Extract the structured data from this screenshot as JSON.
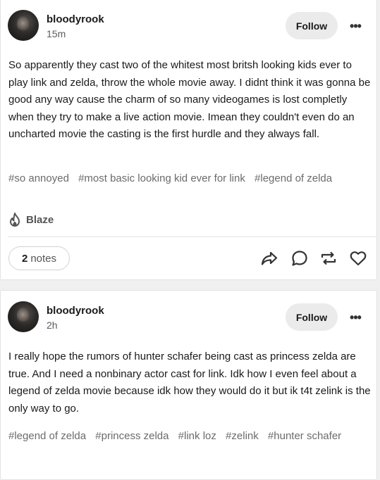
{
  "posts": [
    {
      "username": "bloodyrook",
      "timestamp": "15m",
      "follow_label": "Follow",
      "more_label": "•••",
      "body": "So apparently they cast two of the whitest most britsh looking kids ever to play link and zelda, throw the whole movie away. I didnt think it was gonna be good any way cause the charm of so many videogames is lost completly when they try to make a live action movie. Imean they couldn't even do an uncharted movie the casting is the first hurdle and they always fall.",
      "tags": [
        "#so annoyed",
        "#most basic looking kid ever for link",
        "#legend of zelda"
      ],
      "blaze_label": "Blaze",
      "notes_count": "2",
      "notes_label": "notes",
      "actions": [
        "share-icon",
        "reply-icon",
        "reblog-icon",
        "like-icon"
      ]
    },
    {
      "username": "bloodyrook",
      "timestamp": "2h",
      "follow_label": "Follow",
      "more_label": "•••",
      "body": "I really hope the rumors of hunter schafer being cast as princess zelda are true. And I need a nonbinary actor cast for link. Idk how I even feel about a legend of zelda movie because idk how they would do it but ik t4t zelink is the only way to go.",
      "tags": [
        "#legend of zelda",
        "#princess zelda",
        "#link loz",
        "#zelink",
        "#hunter schafer"
      ]
    }
  ],
  "colors": {
    "background": "#f0f0f0",
    "card": "#ffffff",
    "tag_text": "#6b6b6b",
    "follow_bg": "#ebebeb"
  }
}
